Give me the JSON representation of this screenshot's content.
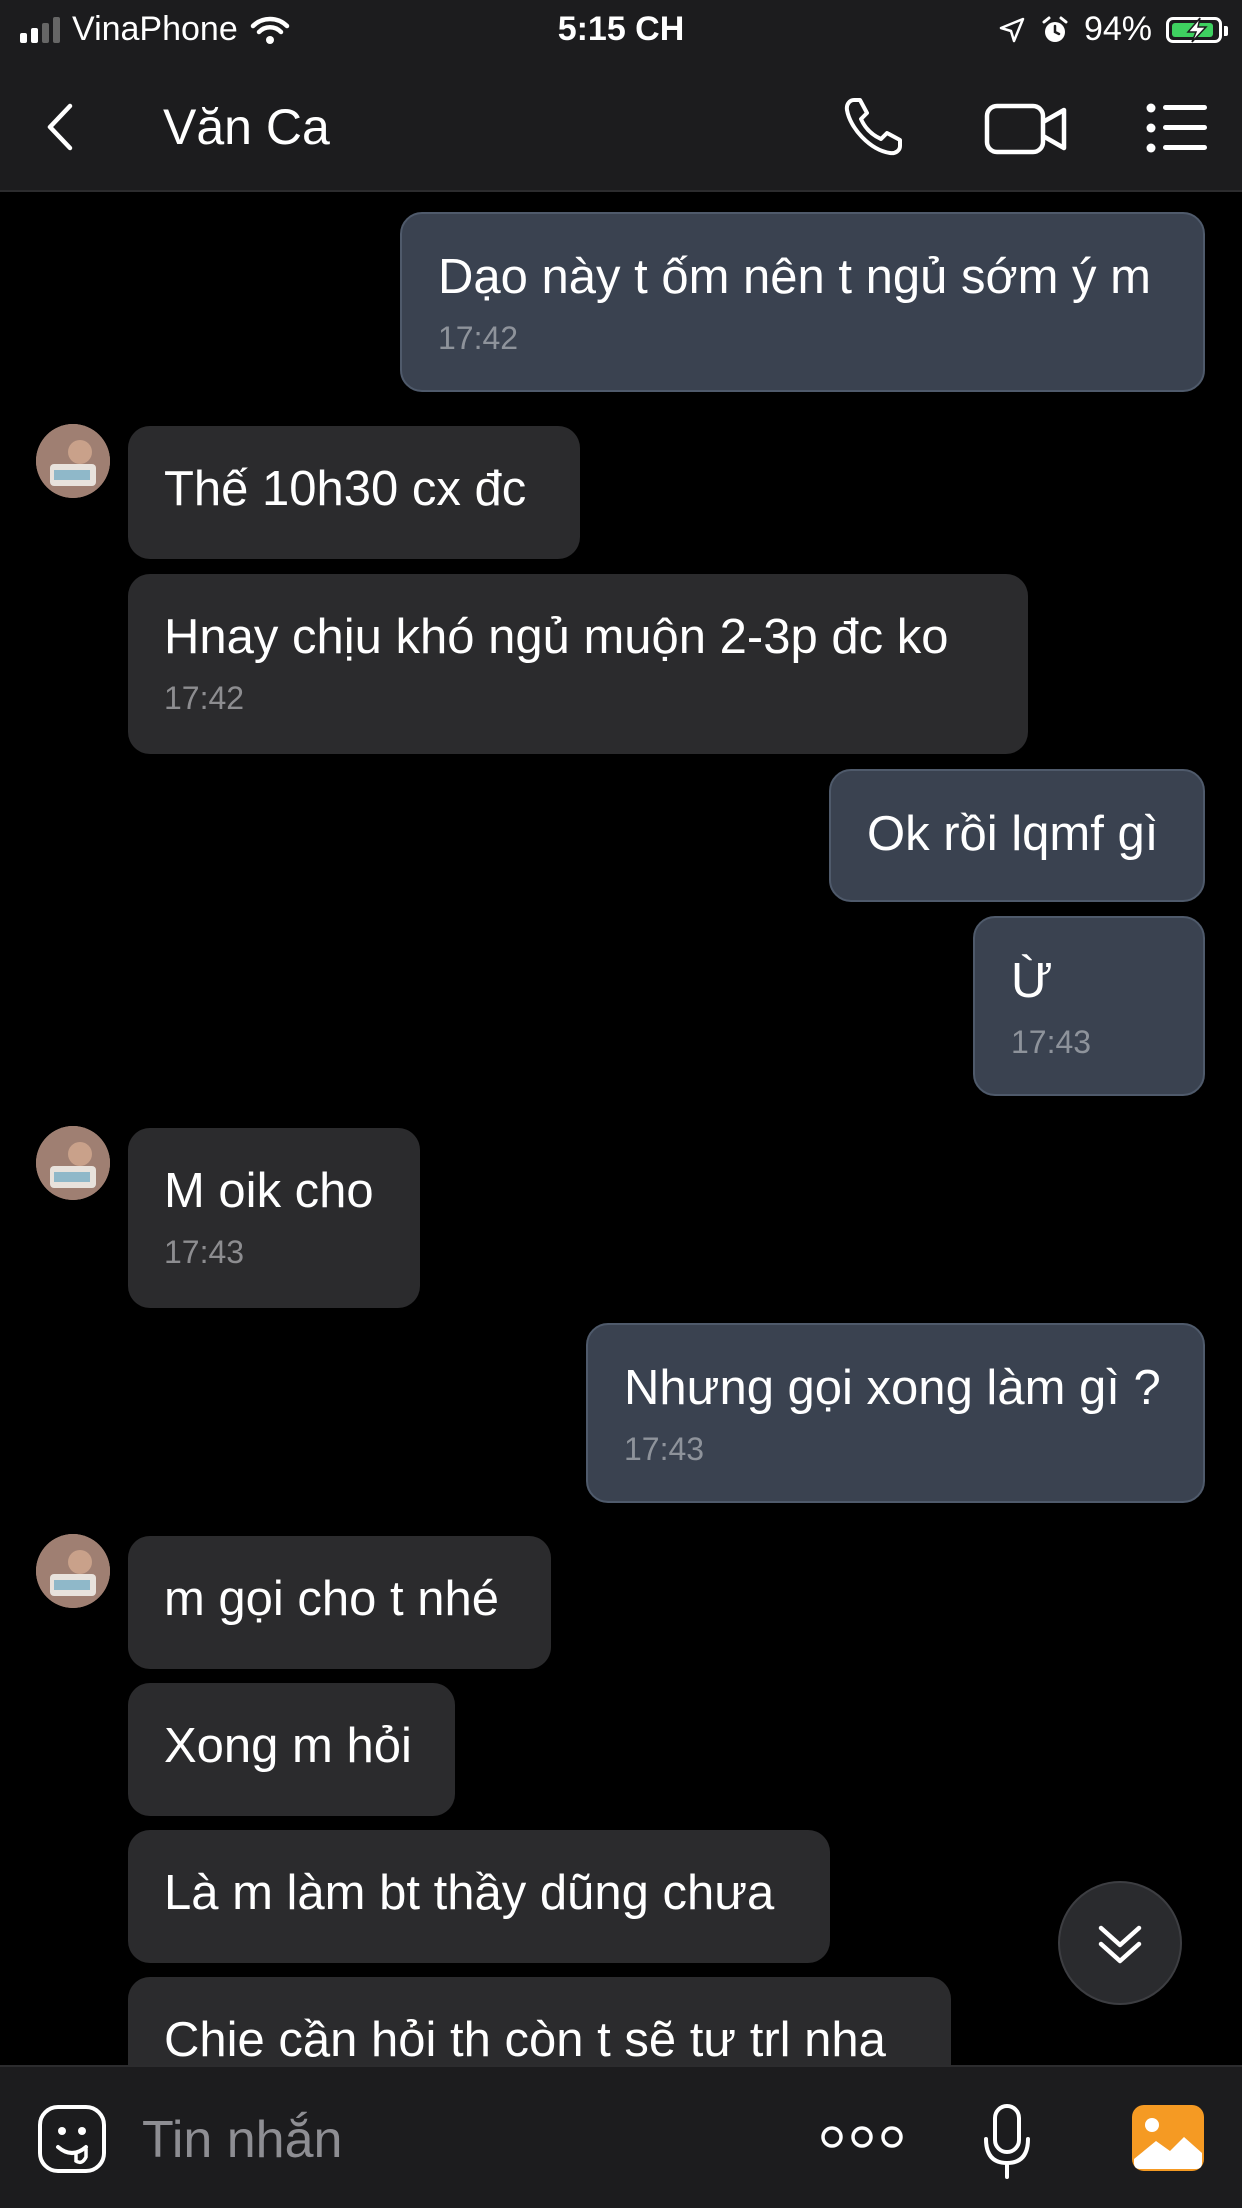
{
  "status_bar": {
    "carrier": "VinaPhone",
    "time": "5:15 CH",
    "battery_percent": "94%",
    "battery_level": 0.94,
    "icons": [
      "signal-icon",
      "wifi-icon",
      "location-arrow-icon",
      "alarm-icon",
      "battery-charging-icon"
    ]
  },
  "header": {
    "title": "Văn Ca",
    "icons": [
      "back-chevron-icon",
      "phone-call-icon",
      "video-call-icon",
      "menu-list-icon"
    ]
  },
  "messages": [
    {
      "direction": "out",
      "text": "Dạo này t ốm nên t ngủ sớm ý m",
      "time": "17:42"
    },
    {
      "direction": "in",
      "text": "Thế 10h30 cx đc",
      "time": ""
    },
    {
      "direction": "in",
      "text": "Hnay chịu khó ngủ muộn 2-3p đc ko",
      "time": "17:42"
    },
    {
      "direction": "out",
      "text": "Ok rồi lqmf gì",
      "time": ""
    },
    {
      "direction": "out",
      "text": "Ừ",
      "time": "17:43"
    },
    {
      "direction": "in",
      "text": "M oik cho",
      "time": "17:43"
    },
    {
      "direction": "out",
      "text": "Nhưng gọi xong làm gì ?",
      "time": "17:43"
    },
    {
      "direction": "in",
      "text": "m gọi cho t nhé",
      "time": ""
    },
    {
      "direction": "in",
      "text": "Xong m hỏi",
      "time": ""
    },
    {
      "direction": "in",
      "text": "Là m làm bt thầy dũng chưa",
      "time": ""
    },
    {
      "direction": "in",
      "text": "Chie cần hỏi th còn t sẽ tư trl nha",
      "time": ""
    }
  ],
  "input_bar": {
    "placeholder": "Tin nhắn",
    "icons": [
      "emoji-sticker-icon",
      "more-dots-icon",
      "microphone-icon",
      "photo-gallery-icon"
    ]
  },
  "colors": {
    "background": "#000000",
    "outgoing_bubble": "#3a4250",
    "incoming_bubble": "#2b2b2d",
    "bar": "#1c1c1e",
    "photo_button": "#f59a23",
    "battery_fill": "#3ed160"
  }
}
